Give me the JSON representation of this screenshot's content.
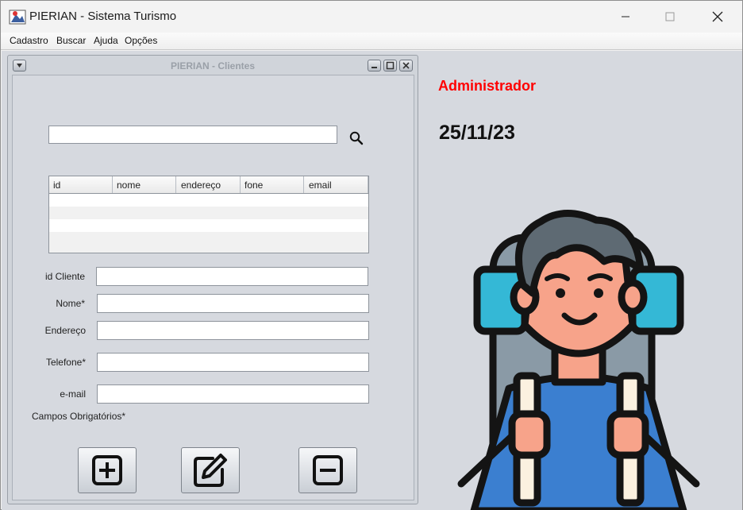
{
  "window": {
    "title": "PIERIAN - Sistema Turismo",
    "controls": [
      "minimize-icon",
      "maximize-icon",
      "close-icon"
    ]
  },
  "menubar": {
    "items": [
      "Cadastro",
      "Buscar",
      "Ajuda",
      "Opções"
    ]
  },
  "desktop": {
    "user_label": "Administrador",
    "date": "25/11/23",
    "colors": {
      "user_label": "#ff0000",
      "background": "#d6d9df"
    }
  },
  "clients_frame": {
    "title": "PIERIAN - Clientes",
    "search": {
      "value": "",
      "placeholder": ""
    },
    "table": {
      "columns": [
        "id",
        "nome",
        "endereço",
        "fone",
        "email"
      ],
      "rows": []
    },
    "fields": [
      {
        "label": "id Cliente",
        "value": ""
      },
      {
        "label": "Nome*",
        "value": ""
      },
      {
        "label": "Endereço",
        "value": ""
      },
      {
        "label": "Telefone*",
        "value": ""
      },
      {
        "label": "e-mail",
        "value": ""
      }
    ],
    "required_note": "Campos Obrigatórios*",
    "buttons": [
      "add-icon",
      "edit-icon",
      "remove-icon"
    ]
  }
}
